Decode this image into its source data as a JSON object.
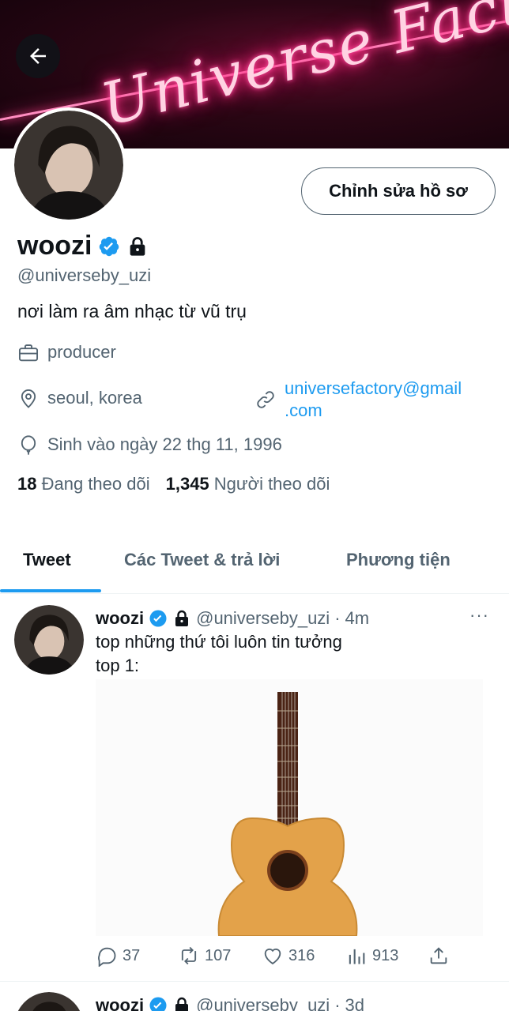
{
  "banner": {
    "neon_text": "Universe Factory"
  },
  "profile": {
    "edit_label": "Chỉnh sửa hồ sơ",
    "name": "woozi",
    "handle": "@universeby_uzi",
    "bio": "nơi làm ra âm nhạc từ vũ trụ",
    "job": "producer",
    "location": "seoul, korea",
    "link_line1": "universefactory@gmail",
    "link_line2": ".com",
    "birthday": "Sinh vào ngày 22 thg 11, 1996",
    "following_count": "18",
    "following_label": "Đang theo dõi",
    "followers_count": "1,345",
    "followers_label": "Người theo dõi"
  },
  "tabs": [
    {
      "label": "Tweet"
    },
    {
      "label": "Các Tweet & trả lời"
    },
    {
      "label": "Phương tiện"
    }
  ],
  "tweets": [
    {
      "name": "woozi",
      "handle": "@universeby_uzi",
      "dot": "·",
      "time": "4m",
      "more": "···",
      "text": "top những thứ tôi luôn tin tưởng\ntop 1:",
      "replies": "37",
      "retweets": "107",
      "likes": "316",
      "views": "913"
    },
    {
      "name": "woozi",
      "handle": "@universeby_uzi",
      "dot": "·",
      "time": "3d"
    }
  ],
  "colors": {
    "accent": "#1d9bf0",
    "secondary_text": "#536471",
    "text": "#0f1419"
  }
}
